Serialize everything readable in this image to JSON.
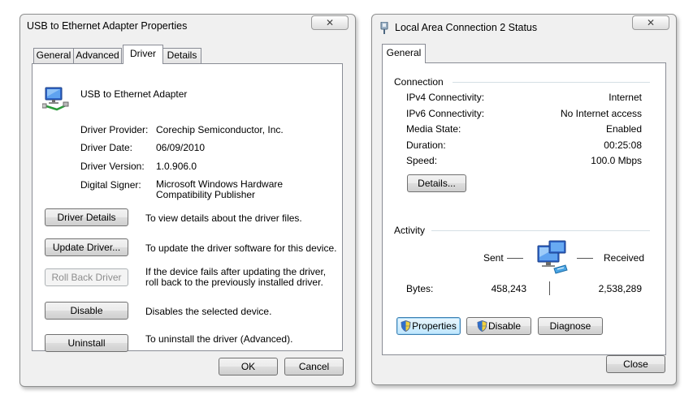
{
  "props": {
    "title": "USB to Ethernet Adapter Properties",
    "close_glyph": "✕",
    "tabs": [
      "General",
      "Advanced",
      "Driver",
      "Details"
    ],
    "device_name": "USB to Ethernet Adapter",
    "fields": [
      {
        "label": "Driver Provider:",
        "value": "Corechip Semiconductor, Inc."
      },
      {
        "label": "Driver Date:",
        "value": "06/09/2010"
      },
      {
        "label": "Driver Version:",
        "value": "1.0.906.0"
      },
      {
        "label": "Digital Signer:",
        "value": "Microsoft Windows Hardware Compatibility Publisher"
      }
    ],
    "actions": [
      {
        "button": "Driver Details",
        "desc": "To view details about the driver files."
      },
      {
        "button": "Update Driver...",
        "desc": "To update the driver software for this device."
      },
      {
        "button": "Roll Back Driver",
        "desc": "If the device fails after updating the driver, roll back to the previously installed driver."
      },
      {
        "button": "Disable",
        "desc": "Disables the selected device."
      },
      {
        "button": "Uninstall",
        "desc": "To uninstall the driver (Advanced)."
      }
    ],
    "ok": "OK",
    "cancel": "Cancel"
  },
  "status": {
    "title": "Local Area Connection 2 Status",
    "close_glyph": "✕",
    "tab": "General",
    "connection_heading": "Connection",
    "connection": [
      {
        "label": "IPv4 Connectivity:",
        "value": "Internet"
      },
      {
        "label": "IPv6 Connectivity:",
        "value": "No Internet access"
      },
      {
        "label": "Media State:",
        "value": "Enabled"
      },
      {
        "label": "Duration:",
        "value": "00:25:08"
      },
      {
        "label": "Speed:",
        "value": "100.0 Mbps"
      }
    ],
    "details_button": "Details...",
    "activity_heading": "Activity",
    "sent_label": "Sent",
    "received_label": "Received",
    "bytes_label": "Bytes:",
    "bytes_sent": "458,243",
    "bytes_received": "2,538,289",
    "properties_button": "Properties",
    "disable_button": "Disable",
    "diagnose_button": "Diagnose",
    "close_button": "Close"
  },
  "icons": {
    "network_adapter": "network-adapter-icon",
    "network_status": "network-status-icon",
    "uac_shield": "uac-shield-icon"
  }
}
